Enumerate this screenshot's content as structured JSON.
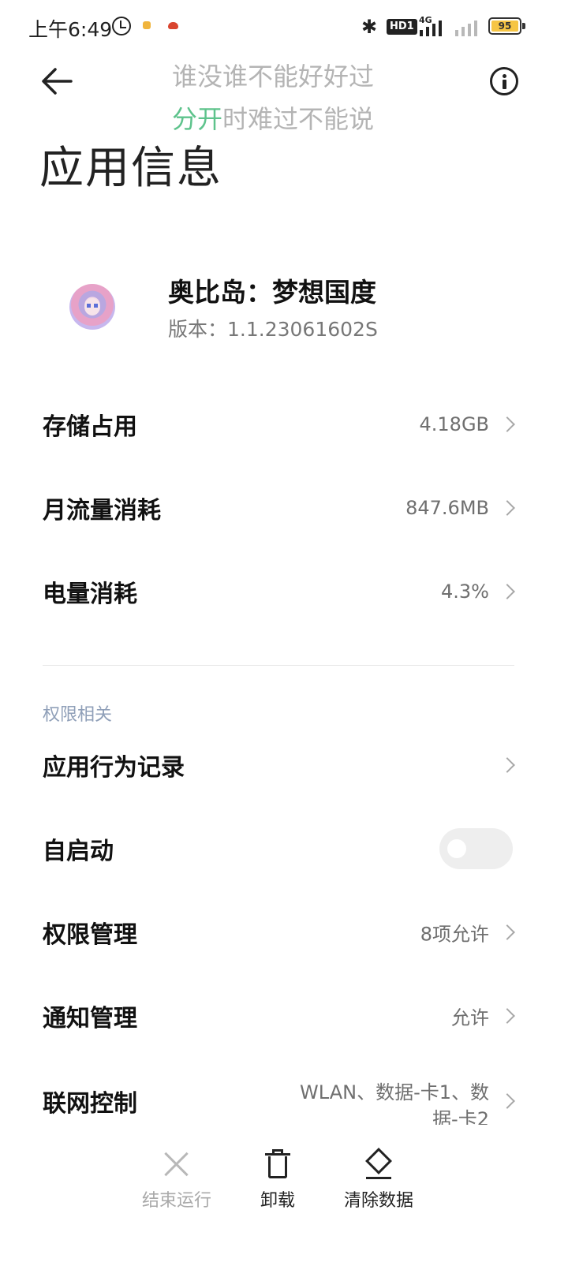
{
  "status_bar": {
    "time": "上午6:49",
    "hd_label": "HD1",
    "network": "4G",
    "battery": "95",
    "icons": [
      "alarm-icon",
      "app-notification-icon",
      "app-notification-icon",
      "bluetooth-icon",
      "signal-icon",
      "signal-empty-icon",
      "battery-icon"
    ]
  },
  "header": {
    "title": "应用信息",
    "back_icon": "back-arrow-icon",
    "info_icon": "info-icon"
  },
  "lyrics": {
    "line1": "谁没谁不能好好过",
    "line2_highlight": "分开",
    "line2_rest": "时难过不能说",
    "highlight_color": "#5ec38c"
  },
  "app": {
    "name": "奥比岛：梦想国度",
    "version": "版本：1.1.23061602S"
  },
  "usage_rows": [
    {
      "label": "存储占用",
      "value": "4.18GB"
    },
    {
      "label": "月流量消耗",
      "value": "847.6MB"
    },
    {
      "label": "电量消耗",
      "value": "4.3%"
    }
  ],
  "permissions_section": {
    "title": "权限相关",
    "behavior_record": {
      "label": "应用行为记录"
    },
    "autostart": {
      "label": "自启动",
      "enabled": false
    },
    "permission_manage": {
      "label": "权限管理",
      "value": "8项允许"
    },
    "notification_manage": {
      "label": "通知管理",
      "value": "允许"
    },
    "network_control": {
      "label": "联网控制",
      "value": "WLAN、数据-卡1、数据-卡2"
    }
  },
  "actions": {
    "stop": {
      "label": "结束运行",
      "enabled": false
    },
    "uninstall": {
      "label": "卸载"
    },
    "clear_data": {
      "label": "清除数据"
    }
  }
}
